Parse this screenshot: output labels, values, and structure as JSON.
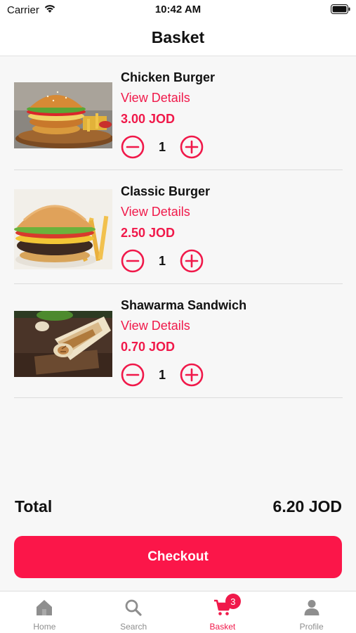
{
  "status_bar": {
    "carrier": "Carrier",
    "time": "10:42 AM"
  },
  "nav": {
    "title": "Basket"
  },
  "items": [
    {
      "name": "Chicken Burger",
      "details_label": "View Details",
      "price": "3.00 JOD",
      "quantity": "1",
      "image": "chicken-burger-photo"
    },
    {
      "name": "Classic Burger",
      "details_label": "View Details",
      "price": "2.50 JOD",
      "quantity": "1",
      "image": "classic-burger-photo"
    },
    {
      "name": "Shawarma Sandwich",
      "details_label": "View Details",
      "price": "0.70 JOD",
      "quantity": "1",
      "image": "shawarma-sandwich-photo"
    }
  ],
  "total": {
    "label": "Total",
    "value": "6.20 JOD"
  },
  "checkout": {
    "label": "Checkout"
  },
  "tabs": [
    {
      "label": "Home",
      "icon": "home-icon"
    },
    {
      "label": "Search",
      "icon": "search-icon"
    },
    {
      "label": "Basket",
      "icon": "cart-icon",
      "badge": "3",
      "active": true
    },
    {
      "label": "Profile",
      "icon": "person-icon"
    }
  ],
  "colors": {
    "accent": "#f0194a",
    "checkout": "#fb1649",
    "inactive_tab": "#8e8e8e"
  }
}
